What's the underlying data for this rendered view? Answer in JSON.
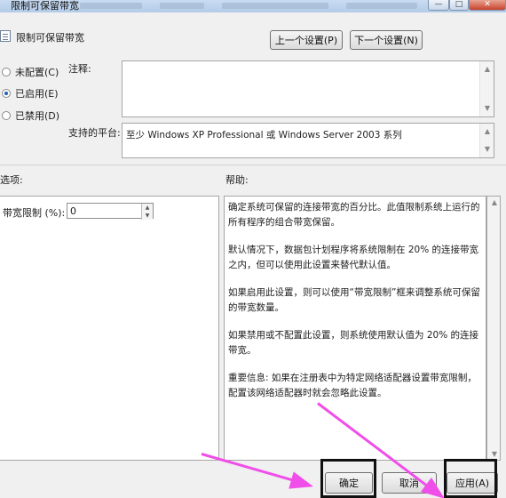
{
  "window": {
    "title": "限制可保留带宽",
    "buttons": {
      "minimize": "—",
      "maximize": "□",
      "close": "✕"
    }
  },
  "header": {
    "policy_name": "限制可保留带宽",
    "prev_button": "上一个设置(P)",
    "next_button": "下一个设置(N)"
  },
  "state": {
    "options": [
      {
        "label": "未配置(C)",
        "selected": false
      },
      {
        "label": "已启用(E)",
        "selected": true
      },
      {
        "label": "已禁用(D)",
        "selected": false
      }
    ]
  },
  "comment": {
    "label": "注释:",
    "value": ""
  },
  "platform": {
    "label": "支持的平台:",
    "value": "至少 Windows XP Professional 或 Windows Server 2003 系列"
  },
  "options_panel": {
    "label": "选项:",
    "limit_label": "带宽限制 (%):",
    "limit_value": "0"
  },
  "help_panel": {
    "label": "帮助:",
    "paragraphs": [
      "确定系统可保留的连接带宽的百分比。此值限制系统上运行的所有程序的组合带宽保留。",
      "默认情况下，数据包计划程序将系统限制在 20% 的连接带宽之内，但可以使用此设置来替代默认值。",
      "如果启用此设置，则可以使用“带宽限制”框来调整系统可保留的带宽数量。",
      "如果禁用或不配置此设置，则系统使用默认值为 20% 的连接带宽。",
      "重要信息: 如果在注册表中为特定网络适配器设置带宽限制，配置该网络适配器时就会忽略此设置。"
    ]
  },
  "footer": {
    "ok_button": "确定",
    "cancel_button": "取消",
    "apply_button": "应用(A)"
  },
  "colors": {
    "annotation_arrow": "#f04ee9",
    "highlight_box": "#111111"
  }
}
